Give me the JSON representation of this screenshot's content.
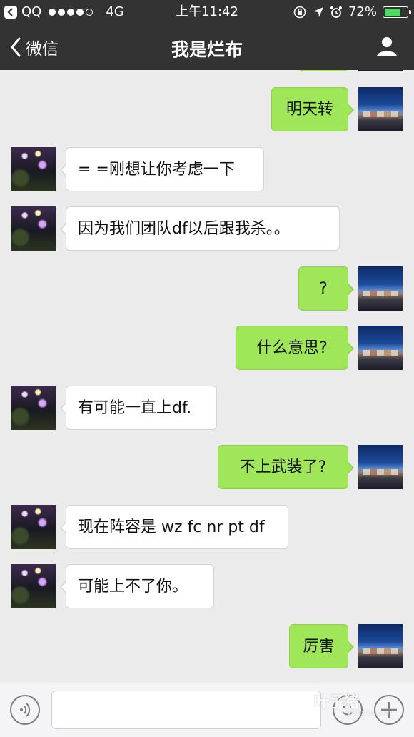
{
  "status_bar": {
    "carrier": "QQ",
    "network": "4G",
    "time": "上午11:42",
    "battery": "72%"
  },
  "nav": {
    "back_label": "微信",
    "title": "我是烂布"
  },
  "messages": [
    {
      "side": "right",
      "text": "明天转"
    },
    {
      "side": "left",
      "text": "= =刚想让你考虑一下"
    },
    {
      "side": "left",
      "text": "因为我们团队df以后跟我杀。。"
    },
    {
      "side": "right",
      "text": "?"
    },
    {
      "side": "right",
      "text": "什么意思?"
    },
    {
      "side": "left",
      "text": "有可能一直上df."
    },
    {
      "side": "right",
      "text": "不上武装了?"
    },
    {
      "side": "left",
      "text": "现在阵容是 wz fc nr pt df"
    },
    {
      "side": "left",
      "text": "可能上不了你。"
    },
    {
      "side": "right",
      "text": "厉害"
    }
  ],
  "input": {
    "value": "",
    "placeholder": ""
  },
  "watermark": {
    "text": "叶子猪",
    "sub": "yezizhu.com"
  },
  "colors": {
    "header_bg": "#333334",
    "chat_bg": "#ebebeb",
    "my_bubble": "#9fe658",
    "their_bubble": "#ffffff",
    "battery": "#4cd964"
  }
}
